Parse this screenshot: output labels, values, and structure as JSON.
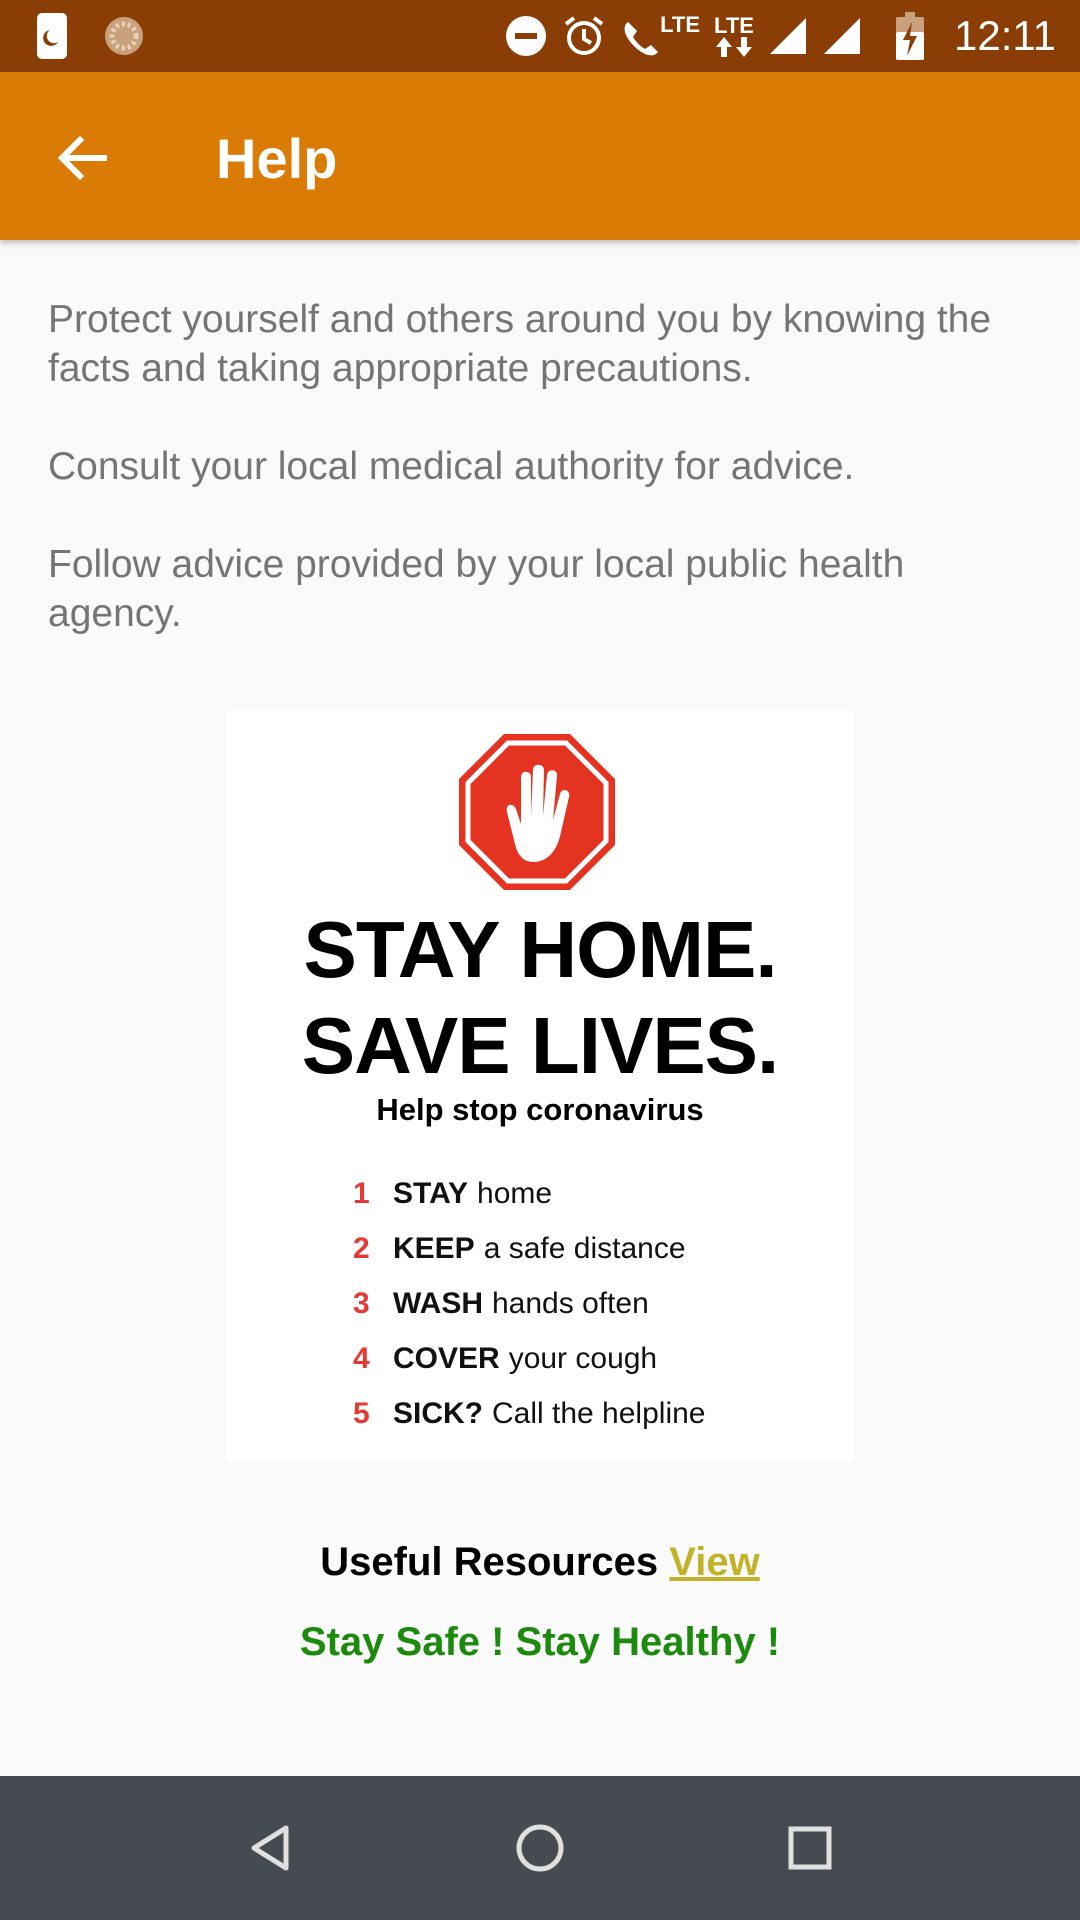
{
  "status_bar": {
    "time": "12:11",
    "lte_1": "LTE",
    "lte_2": "LTE",
    "icons": [
      "notification-app-icon",
      "loading-icon",
      "do-not-disturb-icon",
      "alarm-icon",
      "volte-call-icon",
      "data-arrows-icon",
      "signal-icon",
      "signal-icon",
      "battery-charging-icon"
    ]
  },
  "app_bar": {
    "title": "Help",
    "back_icon": "arrow-back-icon",
    "color": "#d97b04"
  },
  "intro": {
    "paragraph_1": "Protect yourself and others around you by knowing the facts and taking appropriate precautions.",
    "paragraph_2": "Consult your local medical authority for advice.",
    "paragraph_3": "Follow advice provided by your local public health agency."
  },
  "poster": {
    "icon": "stop-hand-icon",
    "headline_1": "STAY HOME.",
    "headline_2": "SAVE LIVES.",
    "subhead": "Help stop coronavirus",
    "steps": [
      {
        "num": "1",
        "key": "STAY",
        "rest": "home"
      },
      {
        "num": "2",
        "key": "KEEP",
        "rest": "a safe distance"
      },
      {
        "num": "3",
        "key": "WASH",
        "rest": "hands often"
      },
      {
        "num": "4",
        "key": "COVER",
        "rest": "your cough"
      },
      {
        "num": "5",
        "key": "SICK?",
        "rest": "Call the helpline"
      }
    ]
  },
  "resources": {
    "label": "Useful Resources",
    "link": "View",
    "link_color": "#c2b22a"
  },
  "tagline": {
    "text": "Stay Safe ! Stay Healthy !",
    "color": "#1c8a0c"
  },
  "nav_bar": {
    "icons": [
      "back-triangle-icon",
      "home-circle-icon",
      "recents-square-icon"
    ]
  }
}
